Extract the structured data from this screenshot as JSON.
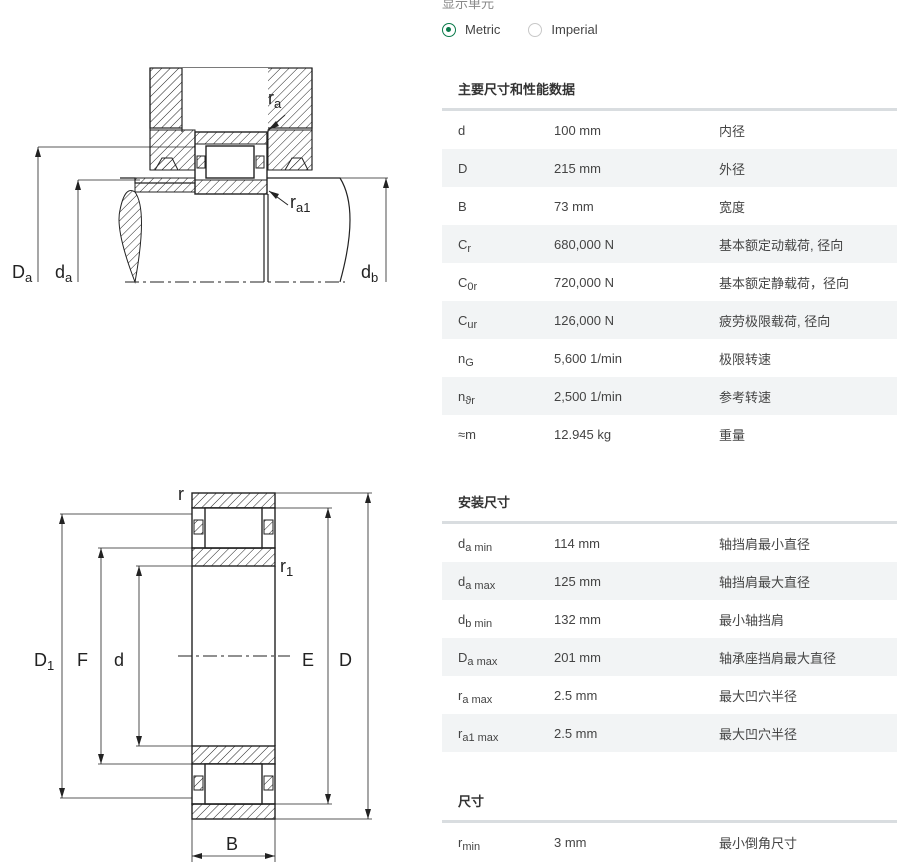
{
  "units": {
    "caption": "显示单元",
    "options": [
      {
        "label": "Metric",
        "selected": true
      },
      {
        "label": "Imperial",
        "selected": false
      }
    ]
  },
  "drawings": {
    "mount": {
      "labels": [
        "ra",
        "ra1",
        "Da",
        "da",
        "db"
      ]
    },
    "section": {
      "labels": [
        "r",
        "r1",
        "D1",
        "F",
        "d",
        "E",
        "D",
        "B"
      ]
    }
  },
  "sections": [
    {
      "title": "主要尺寸和性能数据",
      "rows": [
        {
          "sym": "d",
          "sub": "",
          "value": "100 mm",
          "desc": "内径"
        },
        {
          "sym": "D",
          "sub": "",
          "value": "215 mm",
          "desc": "外径"
        },
        {
          "sym": "B",
          "sub": "",
          "value": "73 mm",
          "desc": "宽度"
        },
        {
          "sym": "C",
          "sub": "r",
          "value": "680,000 N",
          "desc": "基本额定动载荷, 径向"
        },
        {
          "sym": "C",
          "sub": "0r",
          "value": "720,000 N",
          "desc": "基本额定静载荷，径向"
        },
        {
          "sym": "C",
          "sub": "ur",
          "value": "126,000 N",
          "desc": "疲劳极限载荷, 径向"
        },
        {
          "sym": "n",
          "sub": "G",
          "value": "5,600 1/min",
          "desc": "极限转速"
        },
        {
          "sym": "n",
          "sub": "ϑr",
          "value": "2,500 1/min",
          "desc": "参考转速"
        },
        {
          "sym": "≈m",
          "sub": "",
          "value": "12.945 kg",
          "desc": "重量"
        }
      ]
    },
    {
      "title": "安装尺寸",
      "rows": [
        {
          "sym": "d",
          "sub": "a min",
          "value": "114 mm",
          "desc": "轴挡肩最小直径"
        },
        {
          "sym": "d",
          "sub": "a max",
          "value": "125 mm",
          "desc": "轴挡肩最大直径"
        },
        {
          "sym": "d",
          "sub": "b min",
          "value": "132 mm",
          "desc": "最小轴挡肩"
        },
        {
          "sym": "D",
          "sub": "a max",
          "value": "201 mm",
          "desc": "轴承座挡肩最大直径"
        },
        {
          "sym": "r",
          "sub": "a max",
          "value": "2.5 mm",
          "desc": "最大凹穴半径"
        },
        {
          "sym": "r",
          "sub": "a1 max",
          "value": "2.5 mm",
          "desc": "最大凹穴半径"
        }
      ]
    },
    {
      "title": "尺寸",
      "rows": [
        {
          "sym": "r",
          "sub": "min",
          "value": "3 mm",
          "desc": "最小倒角尺寸"
        }
      ]
    }
  ]
}
